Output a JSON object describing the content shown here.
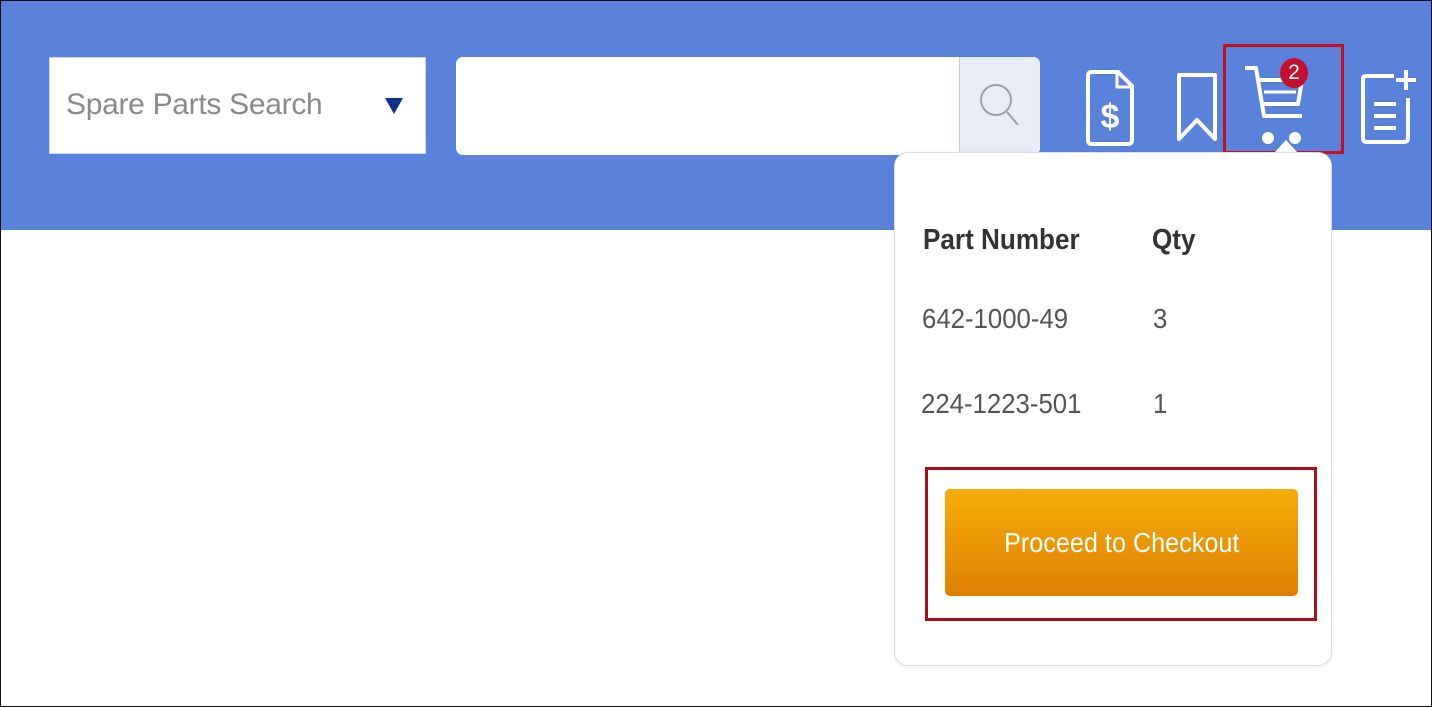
{
  "header": {
    "background": "#5b82da",
    "search_scope": {
      "label": "Spare Parts Search",
      "caret_icon": "triangle-down-icon"
    },
    "search_input": {
      "value": "",
      "placeholder": ""
    },
    "search_button_icon": "search-icon",
    "icons": [
      "invoice-dollar-icon",
      "bookmark-icon",
      "cart-icon",
      "add-list-icon"
    ],
    "cart_badge_count": "2"
  },
  "cart_popover": {
    "columns": [
      "Part Number",
      "Qty"
    ],
    "rows": [
      {
        "part_number": "642-1000-49",
        "qty": "3"
      },
      {
        "part_number": "224-1223-501",
        "qty": "1"
      }
    ],
    "checkout_label": "Proceed to Checkout",
    "checkout_color": "#f0a000"
  },
  "highlight_color": "#c3121d"
}
